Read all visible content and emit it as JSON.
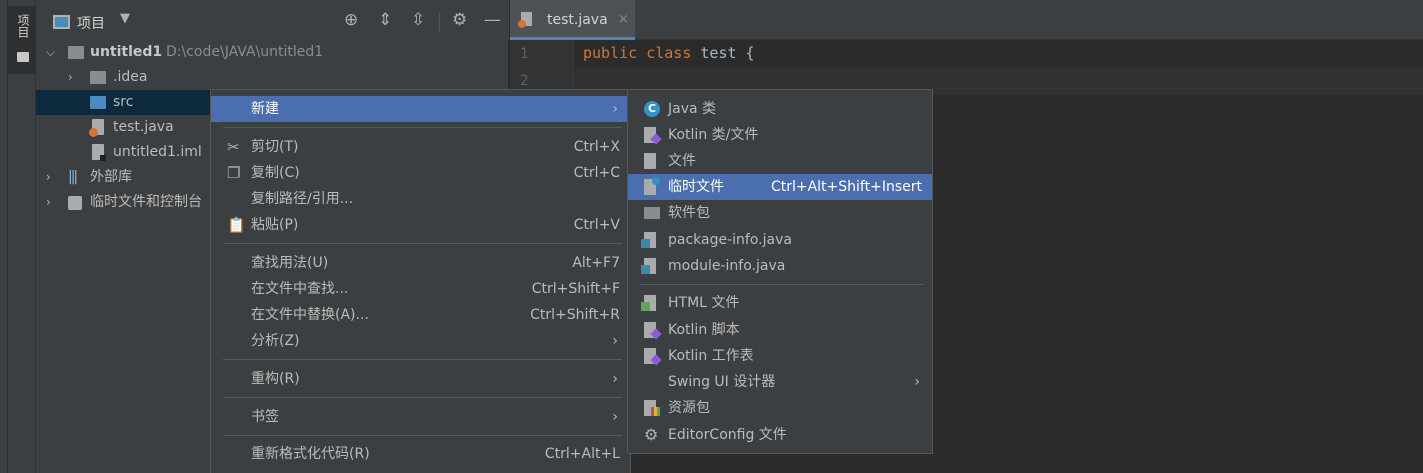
{
  "strip": {
    "tab_label": "项目"
  },
  "project_panel": {
    "title": "项目",
    "tree": [
      {
        "label": "untitled1",
        "path": "D:\\code\\JAVA\\untitled1"
      },
      {
        "label": ".idea"
      },
      {
        "label": "src"
      },
      {
        "label": "test.java"
      },
      {
        "label": "untitled1.iml"
      },
      {
        "label": "外部库"
      },
      {
        "label": "临时文件和控制台"
      }
    ]
  },
  "editor": {
    "tab_label": "test.java",
    "tab_close": "×",
    "line_numbers": [
      "1",
      "2"
    ],
    "code_line1": {
      "kw1": "public",
      "kw2": "class",
      "rest": "test {"
    }
  },
  "context_menu": {
    "items": [
      {
        "label": "新建",
        "shortcut": "",
        "submenu": true
      },
      {
        "label": "剪切(T)",
        "shortcut": "Ctrl+X"
      },
      {
        "label": "复制(C)",
        "shortcut": "Ctrl+C"
      },
      {
        "label": "复制路径/引用...",
        "shortcut": ""
      },
      {
        "label": "粘贴(P)",
        "shortcut": "Ctrl+V"
      },
      {
        "label": "查找用法(U)",
        "shortcut": "Alt+F7"
      },
      {
        "label": "在文件中查找...",
        "shortcut": "Ctrl+Shift+F"
      },
      {
        "label": "在文件中替换(A)...",
        "shortcut": "Ctrl+Shift+R"
      },
      {
        "label": "分析(Z)",
        "shortcut": "",
        "submenu": true
      },
      {
        "label": "重构(R)",
        "shortcut": "",
        "submenu": true
      },
      {
        "label": "书签",
        "shortcut": "",
        "submenu": true
      },
      {
        "label": "重新格式化代码(R)",
        "shortcut": "Ctrl+Alt+L"
      }
    ]
  },
  "new_submenu": {
    "items": [
      {
        "label": "Java 类",
        "icon": "java-class-icon"
      },
      {
        "label": "Kotlin 类/文件",
        "icon": "kotlin-file-icon"
      },
      {
        "label": "文件",
        "icon": "file-icon"
      },
      {
        "label": "临时文件",
        "shortcut": "Ctrl+Alt+Shift+Insert",
        "icon": "scratch-file-icon"
      },
      {
        "label": "软件包",
        "icon": "package-icon"
      },
      {
        "label": "package-info.java",
        "icon": "java-info-icon"
      },
      {
        "label": "module-info.java",
        "icon": "java-info-icon"
      },
      {
        "label": "HTML 文件",
        "icon": "html-icon"
      },
      {
        "label": "Kotlin 脚本",
        "icon": "kotlin-script-icon"
      },
      {
        "label": "Kotlin 工作表",
        "icon": "kotlin-worksheet-icon"
      },
      {
        "label": "Swing UI 设计器",
        "icon": "",
        "submenu": true
      },
      {
        "label": "资源包",
        "icon": "resource-bundle-icon"
      },
      {
        "label": "EditorConfig 文件",
        "icon": "gear-icon"
      }
    ]
  },
  "colors": {
    "highlight": "#4b6eaf",
    "keyword": "#cc7832",
    "selection": "#0d293e"
  }
}
